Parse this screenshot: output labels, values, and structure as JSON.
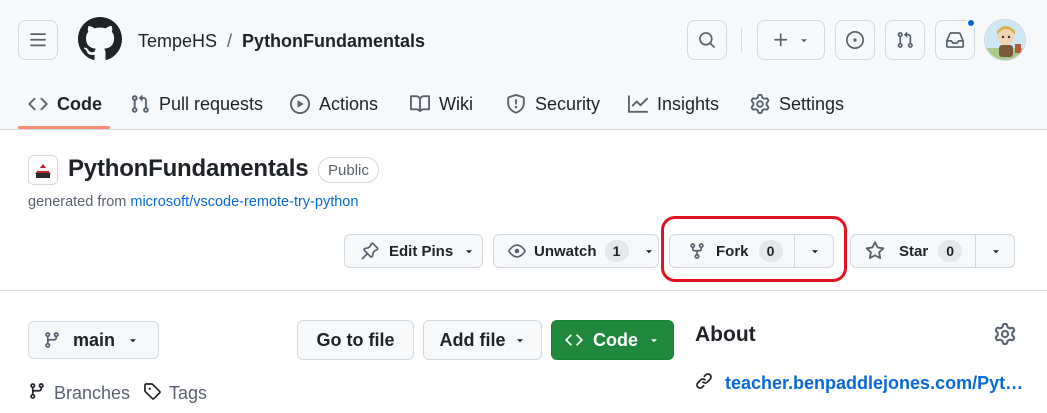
{
  "header": {
    "owner": "TempeHS",
    "separator": "/",
    "repo": "PythonFundamentals"
  },
  "tabs": [
    {
      "label": "Code",
      "icon": "code-icon",
      "selected": true
    },
    {
      "label": "Pull requests",
      "icon": "git-pull-request-icon"
    },
    {
      "label": "Actions",
      "icon": "play-icon"
    },
    {
      "label": "Wiki",
      "icon": "book-icon"
    },
    {
      "label": "Security",
      "icon": "shield-icon"
    },
    {
      "label": "Insights",
      "icon": "graph-icon"
    },
    {
      "label": "Settings",
      "icon": "gear-icon"
    }
  ],
  "repo": {
    "title": "PythonFundamentals",
    "visibility": "Public",
    "generated_prefix": "generated from",
    "template_link": "microsoft/vscode-remote-try-python"
  },
  "actions": {
    "edit_pins": "Edit Pins",
    "unwatch": "Unwatch",
    "unwatch_count": "1",
    "fork": "Fork",
    "fork_count": "0",
    "star": "Star",
    "star_count": "0"
  },
  "toolbar": {
    "branch": "main",
    "go_to_file": "Go to file",
    "add_file": "Add file",
    "code": "Code"
  },
  "meta": {
    "branches": "Branches",
    "tags": "Tags"
  },
  "about": {
    "title": "About",
    "link": "teacher.benpaddlejones.com/Pyth..."
  },
  "colors": {
    "accent": "#0969da",
    "code_button": "#1f883d",
    "tab_underline": "#fd8c73",
    "highlight_ring": "#e0141f",
    "notification_dot": "#0969da"
  }
}
